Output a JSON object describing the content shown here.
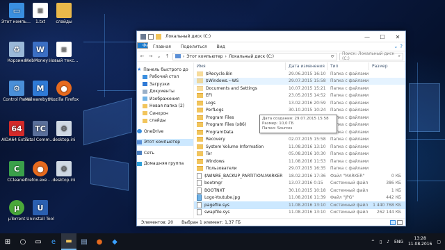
{
  "desktop": {
    "icons": [
      {
        "label": "Этот компьютер",
        "icon": "computer-icon",
        "color": "#3a8fe0"
      },
      {
        "label": "1.txt",
        "icon": "text-file-icon",
        "color": "#ffffff"
      },
      {
        "label": "слайды",
        "icon": "folder-icon",
        "color": "#e9b84a"
      },
      {
        "label": "Корзина",
        "icon": "recycle-bin-icon",
        "color": "#9ab8d8"
      },
      {
        "label": "WebMoney Keeper W...",
        "icon": "webmoney-icon",
        "color": "#3b6fc4"
      },
      {
        "label": "Новый текстовый...",
        "icon": "text-file-icon",
        "color": "#ffffff"
      },
      {
        "label": "Control Panel",
        "icon": "control-panel-icon",
        "color": "#4a8fd8"
      },
      {
        "label": "Malwarebytes Anti-Malw...",
        "icon": "malwarebytes-icon",
        "color": "#2f7ad6"
      },
      {
        "label": "Mozilla Firefox",
        "icon": "firefox-icon",
        "color": "#e66a1e"
      },
      {
        "label": "AIDA64 Extreme E...",
        "icon": "aida64-icon",
        "color": "#d22a2a"
      },
      {
        "label": "Total Commander",
        "icon": "total-commander-icon",
        "color": "#5a6f9a"
      },
      {
        "label": "desktop.ini",
        "icon": "settings-file-icon",
        "color": "#cfd8e3"
      },
      {
        "label": "CCleaner",
        "icon": "ccleaner-icon",
        "color": "#3aa04a"
      },
      {
        "label": "firefox.exe - ярлык",
        "icon": "firefox-icon",
        "color": "#e66a1e"
      },
      {
        "label": "desktop.ini",
        "icon": "settings-file-icon",
        "color": "#cfd8e3"
      },
      {
        "label": "µTorrent",
        "icon": "utorrent-icon",
        "color": "#4aa83a"
      },
      {
        "label": "Uninstall Tool",
        "icon": "uninstall-tool-icon",
        "color": "#2a5fb0"
      }
    ]
  },
  "window": {
    "title": "Локальный диск (C:)",
    "tabs": [
      "Файл",
      "Главная",
      "Поделиться",
      "Вид"
    ],
    "address": {
      "root": "Этот компьютер",
      "current": "Локальный диск (C:)"
    },
    "search_placeholder": "Поиск: Локальный диск (C:)",
    "columns": {
      "name": "Имя",
      "date": "Дата изменения",
      "type": "Тип",
      "size": "Размер"
    },
    "nav": [
      {
        "label": "Панель быстрого до",
        "icon": "star-icon"
      },
      {
        "label": "Рабочий стол",
        "icon": "desktop-icon"
      },
      {
        "label": "Загрузки",
        "icon": "download-icon"
      },
      {
        "label": "Документы",
        "icon": "documents-icon"
      },
      {
        "label": "Изображения",
        "icon": "pictures-icon"
      },
      {
        "label": "Новая папка (2)",
        "icon": "folder-icon"
      },
      {
        "label": "Синхрон",
        "icon": "folder-icon"
      },
      {
        "label": "слайды",
        "icon": "folder-icon"
      },
      {
        "label": "OneDrive",
        "icon": "onedrive-icon"
      },
      {
        "label": "Этот компьютер",
        "icon": "computer-icon"
      },
      {
        "label": "Сеть",
        "icon": "network-icon"
      },
      {
        "label": "Домашняя группа",
        "icon": "homegroup-icon"
      }
    ],
    "files": [
      {
        "name": "$Recycle.Bin",
        "date": "29.06.2015 16:10",
        "type": "Папка с файлами",
        "size": "",
        "kind": "folder-sys"
      },
      {
        "name": "$Windows.~WS",
        "date": "29.07.2015 15:58",
        "type": "Папка с файлами",
        "size": "",
        "kind": "folder-sys"
      },
      {
        "name": "Documents and Settings",
        "date": "10.07.2015 15:21",
        "type": "Папка с файлами",
        "size": "",
        "kind": "folder-sys"
      },
      {
        "name": "EFI",
        "date": "23.05.2015 14:52",
        "type": "Папка с файлами",
        "size": "",
        "kind": "folder"
      },
      {
        "name": "Logs",
        "date": "13.02.2016 20:59",
        "type": "Папка с файлами",
        "size": "",
        "kind": "folder"
      },
      {
        "name": "PerfLogs",
        "date": "30.10.2015 10:24",
        "type": "Папка с файлами",
        "size": "",
        "kind": "folder"
      },
      {
        "name": "Program Files",
        "date": "11.08.2016 11:09",
        "type": "Папка с файлами",
        "size": "",
        "kind": "folder"
      },
      {
        "name": "Program Files (x86)",
        "date": "11.08.2016 11:09",
        "type": "Папка с файлами",
        "size": "",
        "kind": "folder"
      },
      {
        "name": "ProgramData",
        "date": "11.08.2016 12:41",
        "type": "Папка с файлами",
        "size": "",
        "kind": "folder"
      },
      {
        "name": "Recovery",
        "date": "02.07.2015 15:58",
        "type": "Папка с файлами",
        "size": "",
        "kind": "folder"
      },
      {
        "name": "System Volume Information",
        "date": "11.08.2016 13:10",
        "type": "Папка с файлами",
        "size": "",
        "kind": "folder"
      },
      {
        "name": "Tor",
        "date": "05.08.2016 10:30",
        "type": "Папка с файлами",
        "size": "",
        "kind": "folder"
      },
      {
        "name": "Windows",
        "date": "11.08.2016 11:53",
        "type": "Папка с файлами",
        "size": "",
        "kind": "folder"
      },
      {
        "name": "Пользователи",
        "date": "29.07.2015 16:35",
        "type": "Папка с файлами",
        "size": "",
        "kind": "folder"
      },
      {
        "name": "$WINRE_BACKUP_PARTITION.MARKER",
        "date": "18.02.2016 17:36",
        "type": "Файл \"MARKER\"",
        "size": "0 КБ",
        "kind": "file"
      },
      {
        "name": "bootmgr",
        "date": "13.07.2016 0:15",
        "type": "Системный файл",
        "size": "386 КБ",
        "kind": "file"
      },
      {
        "name": "BOOTNXT",
        "date": "30.10.2015 10:18",
        "type": "Системный файл",
        "size": "1 КБ",
        "kind": "file"
      },
      {
        "name": "Logo-Youtube.jpg",
        "date": "11.08.2016 11:39",
        "type": "Файл \"JPG\"",
        "size": "442 КБ",
        "kind": "img"
      },
      {
        "name": "pagefile.sys",
        "date": "11.08.2016 13:10",
        "type": "Системный файл",
        "size": "1 440 768 КБ",
        "kind": "file"
      },
      {
        "name": "swapfile.sys",
        "date": "11.08.2016 13:10",
        "type": "Системный файл",
        "size": "262 144 КБ",
        "kind": "file"
      }
    ],
    "tooltip": {
      "line1": "Дата создания: 29.07.2015 15:58",
      "line2": "Размер: 10,0 ГБ",
      "line3": "Папки: Sources"
    },
    "status": {
      "count": "Элементов: 20",
      "selected": "Выбран 1 элемент: 1,37 ГБ"
    }
  },
  "taskbar": {
    "lang": "ENG",
    "time": "13:28",
    "date": "11.08.2016"
  }
}
